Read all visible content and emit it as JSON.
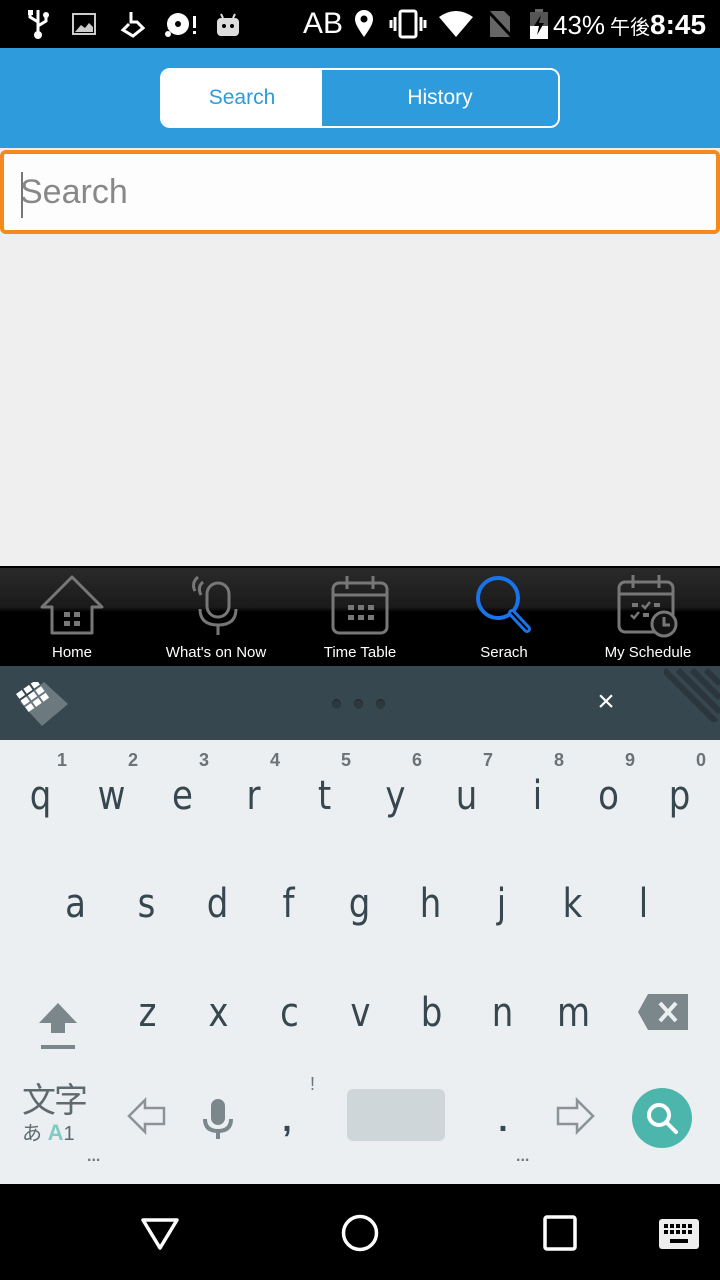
{
  "status_bar": {
    "carrier_text": "AB",
    "battery_percent": "43%",
    "time_ampm": "午後",
    "time": "8:45",
    "icons": [
      "usb-icon",
      "image-icon",
      "download-icon",
      "disc-alert-icon",
      "android-icon",
      "location-icon",
      "vibrate-icon",
      "wifi-icon",
      "no-sim-icon",
      "battery-charging-icon"
    ]
  },
  "header": {
    "tabs": [
      {
        "label": "Search",
        "active": true
      },
      {
        "label": "History",
        "active": false
      }
    ],
    "accent_color": "#2e9bdc"
  },
  "search": {
    "placeholder": "Search",
    "value": "",
    "focus_color": "#f48a1e"
  },
  "bottom_nav": {
    "items": [
      {
        "label": "Home",
        "icon": "home-icon",
        "active": false
      },
      {
        "label": "What's on Now",
        "icon": "microphone-icon",
        "active": false
      },
      {
        "label": "Time Table",
        "icon": "calendar-icon",
        "active": false
      },
      {
        "label": "Serach",
        "icon": "search-icon",
        "active": true
      },
      {
        "label": "My Schedule",
        "icon": "schedule-icon",
        "active": false
      }
    ],
    "active_color": "#1a73e8"
  },
  "keyboard_toolbar": {
    "close_label": "×"
  },
  "keyboard": {
    "row1": [
      {
        "ch": "q",
        "hint": "1"
      },
      {
        "ch": "w",
        "hint": "2"
      },
      {
        "ch": "e",
        "hint": "3"
      },
      {
        "ch": "r",
        "hint": "4"
      },
      {
        "ch": "t",
        "hint": "5"
      },
      {
        "ch": "y",
        "hint": "6"
      },
      {
        "ch": "u",
        "hint": "7"
      },
      {
        "ch": "i",
        "hint": "8"
      },
      {
        "ch": "o",
        "hint": "9"
      },
      {
        "ch": "p",
        "hint": "0"
      }
    ],
    "row2": [
      "a",
      "s",
      "d",
      "f",
      "g",
      "h",
      "j",
      "k",
      "l"
    ],
    "row3": [
      "z",
      "x",
      "c",
      "v",
      "b",
      "n",
      "m"
    ],
    "mode_key": {
      "top": "文字",
      "bottom_hira": "あ",
      "bottom_alpha": "A",
      "bottom_num": "1"
    },
    "comma": ",",
    "comma_hint": "!",
    "period": ".",
    "more": "...",
    "search_color": "#4db6ac"
  }
}
